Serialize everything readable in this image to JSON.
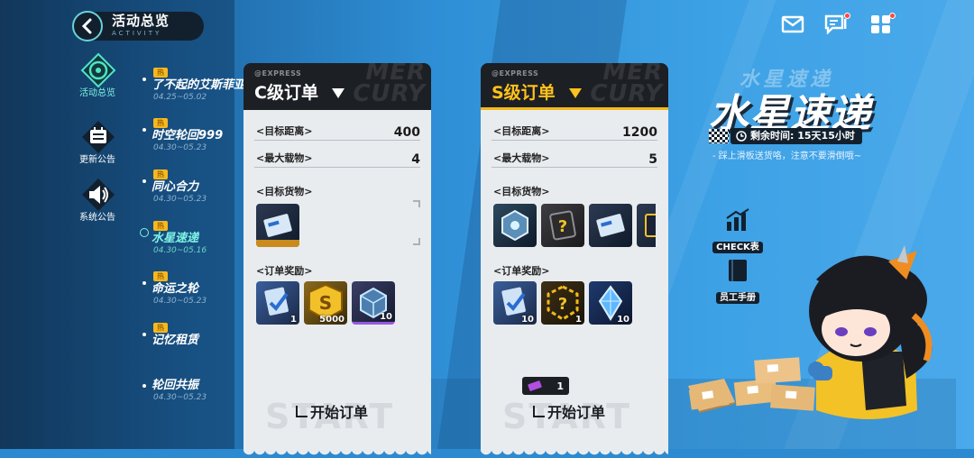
{
  "header": {
    "title": "活动总览",
    "subtitle": "ACTIVITY"
  },
  "topbar": {
    "mail_icon": "mail-icon",
    "chat_icon": "chat-icon",
    "menu_icon": "grid-menu-icon"
  },
  "left_nav": [
    {
      "label": "活动总览",
      "icon": "activity-icon",
      "active": true
    },
    {
      "label": "更新公告",
      "icon": "update-notice-icon"
    },
    {
      "label": "系统公告",
      "icon": "speaker-icon"
    }
  ],
  "events": [
    {
      "hot": "热",
      "name": "了不起的艾斯菲亚",
      "date": "04.25~05.02"
    },
    {
      "hot": "热",
      "name": "时空轮回999",
      "date": "04.30~05.23"
    },
    {
      "hot": "热",
      "name": "同心合力",
      "date": "04.30~05.23"
    },
    {
      "hot": "热",
      "name": "水星速递",
      "date": "04.30~05.16",
      "active": true
    },
    {
      "hot": "热",
      "name": "命运之轮",
      "date": "04.30~05.23"
    },
    {
      "hot": "热",
      "name": "记忆租赁",
      "date": ""
    },
    {
      "hot": "",
      "name": "轮回共振",
      "date": "04.30~05.23"
    }
  ],
  "cards": [
    {
      "express": "@EXPRESS",
      "title": "C级订单",
      "watermark": "MER CURY",
      "distance_label": "<目标距离>",
      "distance": "400",
      "load_label": "<最大载物>",
      "load": "4",
      "goods_label": "<目标货物>",
      "reward_label": "<订单奖励>",
      "rewards": [
        "1",
        "5000",
        "10"
      ],
      "start_label": "开始订单",
      "start_watermark": "START"
    },
    {
      "express": "@EXPRESS",
      "title": "S级订单",
      "watermark": "MER CURY",
      "distance_label": "<目标距离>",
      "distance": "1200",
      "load_label": "<最大载物>",
      "load": "5",
      "goods_label": "<目标货物>",
      "reward_label": "<订单奖励>",
      "rewards": [
        "10",
        "1",
        "10"
      ],
      "extra_reward": "1",
      "start_label": "开始订单",
      "start_watermark": "START"
    }
  ],
  "event_panel": {
    "logo_top": "水星速递",
    "logo": "水星速递",
    "timer": "剩余时间: 15天15小时",
    "tagline": "- 踩上滑板送货咯，注意不要滑倒哦~",
    "check_label": "CHECK表",
    "manual_label": "员工手册"
  },
  "colors": {
    "accent_gold": "#ffc21c",
    "active_cyan": "#7ff3e4",
    "panel_dark": "#1c1f24"
  }
}
